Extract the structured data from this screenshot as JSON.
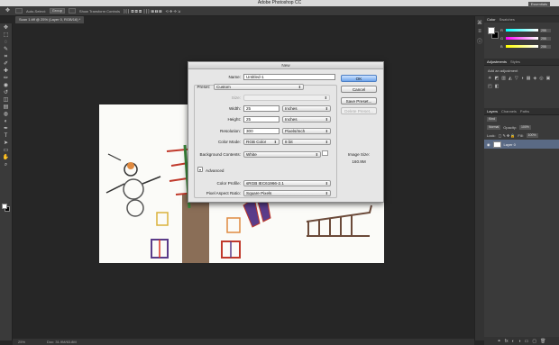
{
  "app": {
    "title": "Adobe Photoshop CC",
    "workspace": "Essentials"
  },
  "options_bar": {
    "items": [
      "Auto-Select:",
      "Group",
      "Show Transform Controls"
    ]
  },
  "document": {
    "tab_label": "Scan 1.tiff @ 25% (Layer 0, RGB/16) *"
  },
  "toolbox": {
    "tools": [
      "move-icon",
      "marquee-icon",
      "lasso-icon",
      "quick-select-icon",
      "crop-icon",
      "eyedropper-icon",
      "healing-icon",
      "brush-icon",
      "stamp-icon",
      "history-brush-icon",
      "eraser-icon",
      "gradient-icon",
      "blur-icon",
      "dodge-icon",
      "pen-icon",
      "type-icon",
      "path-select-icon",
      "shape-icon",
      "hand-icon",
      "zoom-icon"
    ],
    "glyphs": [
      "✥",
      "⬚",
      "◌",
      "✎",
      "⌗",
      "✐",
      "✚",
      "✏",
      "◉",
      "↺",
      "◫",
      "▤",
      "◍",
      "◐",
      "✒",
      "T",
      "➤",
      "▭",
      "✋",
      "⌕"
    ]
  },
  "status": {
    "zoom": "25%",
    "doc": "Doc: 31.9M/63.8M"
  },
  "panels": {
    "color_tabs": [
      "Color",
      "Swatches"
    ],
    "sliders": [
      {
        "channel": "R",
        "value": "255",
        "gradient": "linear-gradient(90deg,#0ff,#fff)"
      },
      {
        "channel": "G",
        "value": "255",
        "gradient": "linear-gradient(90deg,#f0f,#fff)"
      },
      {
        "channel": "B",
        "value": "255",
        "gradient": "linear-gradient(90deg,#ff0,#fff)"
      }
    ],
    "adjust_tabs": [
      "Adjustments",
      "Styles"
    ],
    "adjust_label": "Add an adjustment",
    "adjust_icons": [
      "☀",
      "◩",
      "▥",
      "◭",
      "▽",
      "◑",
      "▦",
      "◈",
      "◎",
      "▣",
      "◰",
      "◧"
    ],
    "layers_tabs": [
      "Layers",
      "Channels",
      "Paths"
    ],
    "kind_label": "Kind",
    "blend_mode": "Normal",
    "opacity_label": "Opacity:",
    "opacity_value": "100%",
    "lock_label": "Lock:",
    "fill_label": "Fill:",
    "fill_value": "100%",
    "layer_name": "Layer 0",
    "footer_icons": [
      "⚭",
      "fx",
      "◐",
      "◑",
      "▭",
      "▢",
      "🗑"
    ]
  },
  "dialog": {
    "title": "New",
    "name_label": "Name:",
    "name_value": "Untitled-1",
    "preset_label": "Preset:",
    "preset_value": "Custom",
    "size_label": "Size:",
    "width_label": "Width:",
    "width_value": "25",
    "width_unit": "Inches",
    "height_label": "Height:",
    "height_value": "25",
    "height_unit": "Inches",
    "resolution_label": "Resolution:",
    "resolution_value": "300",
    "resolution_unit": "Pixels/Inch",
    "color_mode_label": "Color Mode:",
    "color_mode_value": "RGB Color",
    "bit_depth": "8 bit",
    "bg_contents_label": "Background Contents:",
    "bg_contents_value": "White",
    "advanced_label": "Advanced",
    "color_profile_label": "Color Profile:",
    "color_profile_value": "sRGB IEC61966-2.1",
    "pixel_aspect_label": "Pixel Aspect Ratio:",
    "pixel_aspect_value": "Square Pixels",
    "ok_label": "OK",
    "cancel_label": "Cancel",
    "save_preset_label": "Save Preset...",
    "delete_preset_label": "Delete Preset...",
    "image_size_label": "Image Size:",
    "image_size_value": "160.9M"
  }
}
